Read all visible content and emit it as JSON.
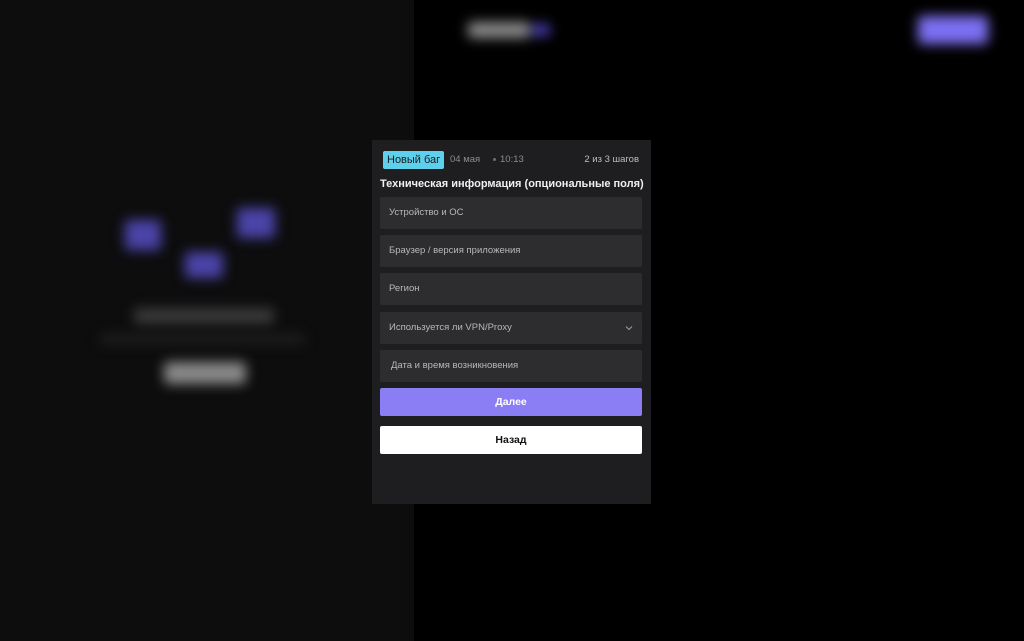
{
  "modal": {
    "badge": "Новый баг",
    "date": "04 мая",
    "time": "10:13",
    "step": "2 из 3 шагов",
    "title": "Техническая информация (опциональные поля)",
    "fields": {
      "device_placeholder": "Устройство и ОС",
      "browser_placeholder": "Браузер / версия приложения",
      "region_placeholder": "Регион",
      "vpn_placeholder": "Используется ли VPN/Proxy",
      "datetime_placeholder": "Дата и время возникновения"
    },
    "next_label": "Далее",
    "back_label": "Назад"
  },
  "colors": {
    "accent": "#8b7df4",
    "badge": "#5fd0ec",
    "modal_bg": "#1e1e20",
    "field_bg": "#2d2d30"
  },
  "icons": {
    "dropdown": "chevron-down-icon"
  }
}
